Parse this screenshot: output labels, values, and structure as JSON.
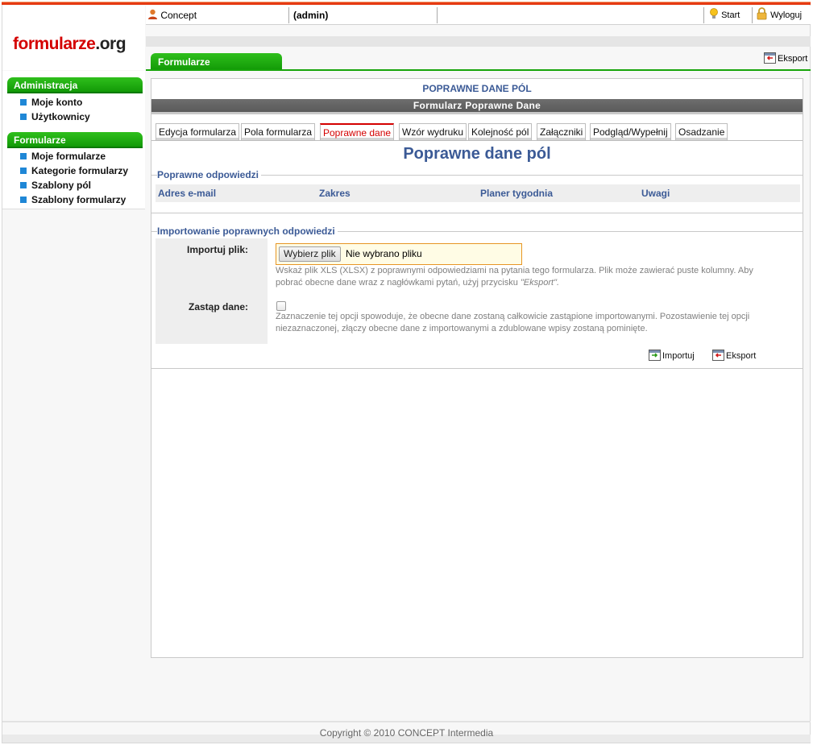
{
  "logo": {
    "part1": "formularze",
    "part2": ".org"
  },
  "topbar": {
    "user_label": "Concept",
    "role_label": "(admin)",
    "start_label": "Start",
    "logout_label": "Wyloguj"
  },
  "sidebar": {
    "sections": [
      {
        "title": "Administracja",
        "items": [
          "Moje konto",
          "Użytkownicy"
        ]
      },
      {
        "title": "Formularze",
        "items": [
          "Moje formularze",
          "Kategorie formularzy",
          "Szablony pól",
          "Szablony formularzy"
        ]
      }
    ]
  },
  "main_tab": {
    "label": "Formularze"
  },
  "export_top_label": "Eksport",
  "panel": {
    "title": "POPRAWNE DANE PÓL",
    "bar_title": "Formularz Poprawne Dane",
    "subtabs": [
      "Edycja formularza",
      "Pola formularza",
      "Poprawne dane",
      "Wzór wydruku",
      "Kolejność pól",
      "Załączniki",
      "Podgląd/Wypełnij",
      "Osadzanie"
    ],
    "active_subtab": "Poprawne dane",
    "heading": "Poprawne dane pól"
  },
  "answers": {
    "legend": "Poprawne odpowiedzi",
    "columns": [
      "Adres e-mail",
      "Zakres",
      "Planer tygodnia",
      "Uwagi"
    ]
  },
  "import": {
    "legend": "Importowanie poprawnych odpowiedzi",
    "file_label": "Importuj plik:",
    "file_button": "Wybierz plik",
    "file_status": "Nie wybrano pliku",
    "file_hint_1": "Wskaż plik XLS (XLSX) z poprawnymi odpowiedziami na pytania tego formularza. Plik może zawierać puste kolumny. Aby",
    "file_hint_2": "pobrać obecne dane wraz z nagłówkami pytań, użyj przycisku",
    "file_hint_2_em": "\"Eksport\".",
    "replace_label": "Zastąp dane:",
    "replace_checked": false,
    "replace_hint_1": "Zaznaczenie tej opcji spowoduje, że obecne dane zostaną całkowicie zastąpione importowanymi. Pozostawienie tej opcji",
    "replace_hint_2": "niezaznaczonej, złączy obecne dane z importowanymi a zdublowane wpisy zostaną pominięte.",
    "import_button": "Importuj",
    "export_button": "Eksport"
  },
  "footer": {
    "copyright": "Copyright © 2010 CONCEPT Intermedia"
  },
  "colors": {
    "accent_green": "#129a07",
    "heading_blue": "#3b5a96",
    "active_red": "#d40000",
    "top_stripe": "#e63a12"
  }
}
